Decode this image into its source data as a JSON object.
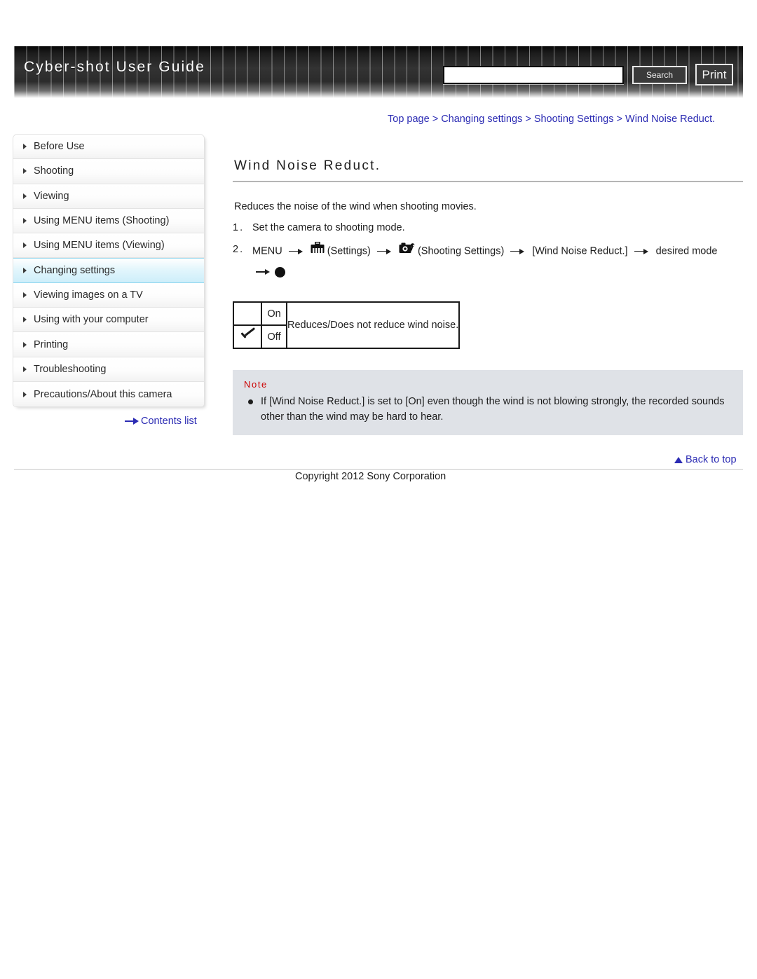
{
  "header": {
    "site_title": "Cyber-shot User Guide",
    "search": {
      "value": "",
      "placeholder": "",
      "button_label": "Search"
    },
    "print_label": "Print"
  },
  "breadcrumb": {
    "items": [
      {
        "label": "Top page"
      },
      {
        "label": "Changing settings"
      },
      {
        "label": "Shooting Settings"
      },
      {
        "label": "Wind Noise Reduct."
      }
    ],
    "separator": ">"
  },
  "sidebar": {
    "items": [
      {
        "label": "Before Use",
        "active": false
      },
      {
        "label": "Shooting",
        "active": false
      },
      {
        "label": "Viewing",
        "active": false
      },
      {
        "label": "Using MENU items (Shooting)",
        "active": false
      },
      {
        "label": "Using MENU items (Viewing)",
        "active": false
      },
      {
        "label": "Changing settings",
        "active": true
      },
      {
        "label": "Viewing images on a TV",
        "active": false
      },
      {
        "label": "Using with your computer",
        "active": false
      },
      {
        "label": "Printing",
        "active": false
      },
      {
        "label": "Troubleshooting",
        "active": false
      },
      {
        "label": "Precautions/About this camera",
        "active": false
      }
    ],
    "contents_link": "Contents list"
  },
  "main": {
    "title": "Wind Noise Reduct.",
    "intro": "Reduces the noise of the wind when shooting movies.",
    "steps": [
      {
        "number": "1.",
        "text": "Set the camera to shooting mode."
      },
      {
        "number": "2.",
        "menu_label": "MENU",
        "settings_label": "(Settings)",
        "shooting_settings_label": "(Shooting Settings)",
        "item_label": "[Wind Noise Reduct.]",
        "desired_mode_label": "desired mode"
      }
    ],
    "options_table": {
      "rows": [
        {
          "check": "",
          "mode": "On",
          "description": "Reduces/Does not reduce wind noise."
        },
        {
          "check": "check-icon",
          "mode": "Off",
          "description": ""
        }
      ]
    },
    "note": {
      "label": "Note",
      "items": [
        "If [Wind Noise Reduct.] is set to [On] even though the wind is not blowing strongly, the recorded sounds other than the wind may be hard to hear."
      ]
    }
  },
  "footer": {
    "back_to_top": "Back to top",
    "copyright": "Copyright 2012 Sony Corporation"
  },
  "colors": {
    "link": "#2b2bb3",
    "note_red": "#cc0000",
    "note_bg": "#dfe2e7",
    "active_nav": "#cdeefa"
  }
}
